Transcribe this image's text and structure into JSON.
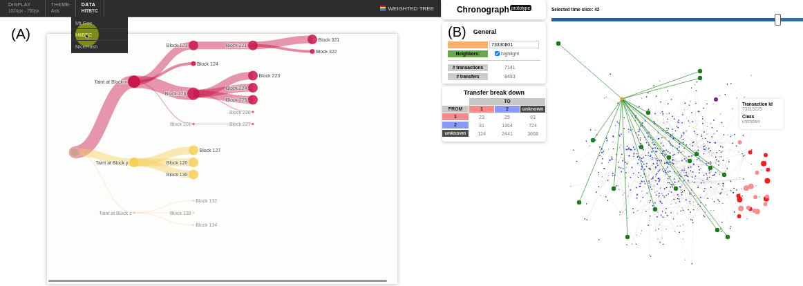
{
  "panel_a": {
    "panel_label": "(A)",
    "menu_tabs": [
      {
        "label": "DISPLAY",
        "value": "1024px - 750px",
        "selected": false
      },
      {
        "label": "THEME",
        "value": "Axis",
        "selected": false
      },
      {
        "label": "DATA",
        "value": "HITBTC",
        "selected": true
      }
    ],
    "data_menu": [
      {
        "label": "Mt.Gox",
        "selected": false
      },
      {
        "label": "HitBTC",
        "selected": true
      },
      {
        "label": "NiceHash",
        "selected": false
      }
    ],
    "view_title": "WEIGHTED TREE",
    "tree": {
      "groups": [
        {
          "label": "Taint at Block x",
          "color": "#c8184a",
          "kind": "heavy",
          "label_right": false,
          "children": [
            {
              "label": "Block 123",
              "kind": "medium",
              "label_right": false,
              "children": [
                {
                  "label": "Block 221",
                  "kind": "medium",
                  "label_right": false,
                  "children": [
                    {
                      "label": "Block 321",
                      "kind": "medium",
                      "label_right": true
                    },
                    {
                      "label": "Block 322",
                      "kind": "light",
                      "label_right": true
                    }
                  ]
                }
              ]
            },
            {
              "label": "Block 124",
              "kind": "light",
              "label_right": true
            },
            {
              "label": "Block 126",
              "kind": "heavy",
              "label_right": false,
              "children": [
                {
                  "label": "Block 223",
                  "kind": "medium",
                  "label_right": true
                },
                {
                  "label": "Block 224",
                  "kind": "medium",
                  "label_right": false
                },
                {
                  "label": "Block 225",
                  "kind": "medium",
                  "label_right": false
                },
                {
                  "label": "Block 226",
                  "kind": "trace",
                  "label_right": false
                }
              ]
            },
            {
              "label": "Block 101",
              "kind": "trace",
              "label_right": false,
              "children": [
                {
                  "label": "Block 227",
                  "kind": "trace",
                  "label_right": false
                }
              ]
            }
          ]
        },
        {
          "label": "Taint at Block y",
          "color": "#f7cf5a",
          "kind": "medium",
          "label_right": false,
          "children": [
            {
              "label": "Block 127",
              "kind": "medium",
              "label_right": true
            },
            {
              "label": "Block 120",
              "kind": "medium",
              "label_right": false
            },
            {
              "label": "Block 130",
              "kind": "medium",
              "label_right": false
            }
          ]
        },
        {
          "label": "Taint at Block z",
          "color": "#f6c7a4",
          "kind": "trace",
          "label_right": false,
          "children": [
            {
              "label": "Block 132",
              "kind": "trace",
              "label_right": true
            },
            {
              "label": "Block 133",
              "kind": "trace",
              "label_right": false
            },
            {
              "label": "Block 134",
              "kind": "trace",
              "label_right": true
            }
          ]
        }
      ]
    }
  },
  "panel_b": {
    "panel_label": "(B)",
    "app_title": "Chronograph",
    "badge": "prototype",
    "general": {
      "title": "General",
      "id_value": "73330801",
      "neighbors_label": "Neighbors:",
      "highlight": {
        "label": "highlight",
        "checked": true
      },
      "stats": [
        {
          "label": "# transactions",
          "value": "7141"
        },
        {
          "label": "# transfers",
          "value": "8493"
        }
      ]
    },
    "transfers": {
      "title": "Transfer break down",
      "to_label": "TO",
      "from_label": "FROM",
      "classes": [
        {
          "label": "1",
          "color": "#f48a8a"
        },
        {
          "label": "2",
          "color": "#8a98f6"
        },
        {
          "label": "unknown",
          "color": "#4a4a4a"
        }
      ],
      "rows": [
        {
          "label": "1",
          "color": "#f48a8a",
          "cells": [
            "23",
            "25",
            "93"
          ]
        },
        {
          "label": "2",
          "color": "#8a98f6",
          "cells": [
            "31",
            "1364",
            "724"
          ]
        },
        {
          "label": "unknown",
          "color": "#4a4a4a",
          "cells": [
            "124",
            "2441",
            "3668"
          ]
        }
      ]
    },
    "time_slice": {
      "label": "Selected time slice: 42",
      "level": 0.9
    },
    "tooltip": [
      {
        "label": "Transaction Id",
        "value": "73315225"
      },
      {
        "label": "Class",
        "value": "unknown"
      }
    ]
  }
}
